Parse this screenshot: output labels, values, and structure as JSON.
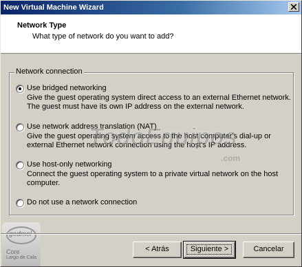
{
  "window": {
    "title": "New Virtual Machine Wizard"
  },
  "header": {
    "title": "Network Type",
    "subtitle": "What type of network do you want to add?"
  },
  "group": {
    "legend": "Network connection"
  },
  "options": [
    {
      "label": "Use bridged networking",
      "selected": true,
      "description": "Give the guest operating system direct access to an external Ethernet network. The guest must have its own IP address on the external network."
    },
    {
      "label": "Use network address translation (NAT)",
      "selected": false,
      "description": "Give the guest operating system access to the host computer's dial-up or external Ethernet network connection using the host's IP address."
    },
    {
      "label": "Use host-only networking",
      "selected": false,
      "description": "Connect the guest operating system to a private virtual network on the host computer."
    },
    {
      "label": "Do not use a network connection",
      "selected": false,
      "description": ""
    }
  ],
  "watermark": {
    "text": "TodoEquipos",
    "suffix": ".com"
  },
  "badge": {
    "brand": "godmol",
    "line1": "Core",
    "line2": "Largo de Cala"
  },
  "buttons": {
    "back": "< Atrás",
    "next": "Siguiente >",
    "cancel": "Cancelar"
  },
  "colors": {
    "titlebar_start": "#0a246a",
    "titlebar_end": "#a6caf0",
    "face": "#d4d0c8"
  }
}
